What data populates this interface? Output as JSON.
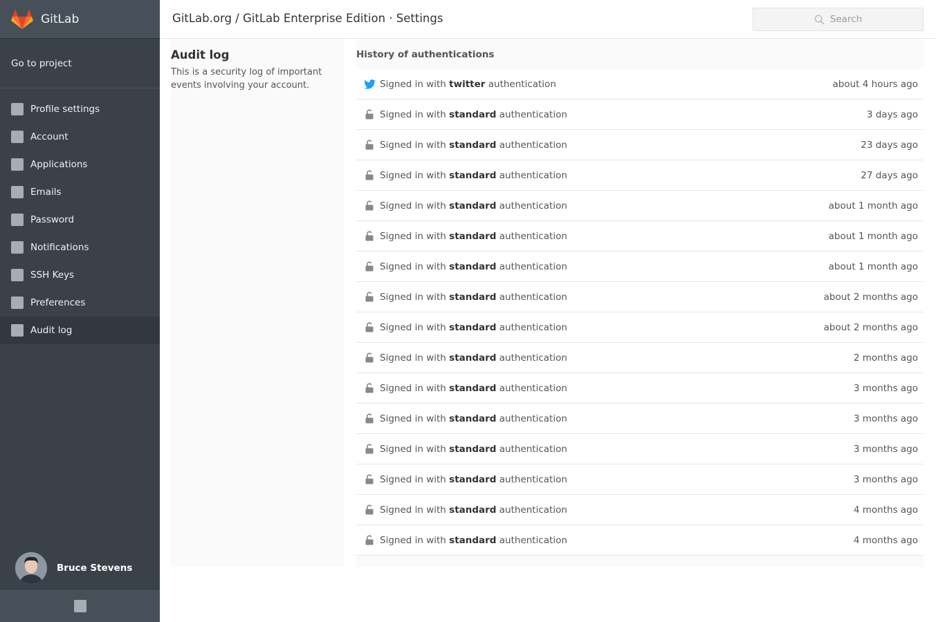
{
  "app": {
    "brand": "GitLab"
  },
  "header": {
    "breadcrumb": "GitLab.org / GitLab Enterprise Edition · Settings",
    "search_placeholder": "Search"
  },
  "sidebar": {
    "go_to_project": "Go to project",
    "items": [
      {
        "label": "Profile settings"
      },
      {
        "label": "Account"
      },
      {
        "label": "Applications"
      },
      {
        "label": "Emails"
      },
      {
        "label": "Password"
      },
      {
        "label": "Notifications"
      },
      {
        "label": "SSH Keys"
      },
      {
        "label": "Preferences"
      },
      {
        "label": "Audit log"
      }
    ],
    "user_name": "Bruce Stevens"
  },
  "page": {
    "title": "Audit log",
    "description": "This is a security log of important events involving your account."
  },
  "history": {
    "heading": "History of authentications",
    "prefix": "Signed in with",
    "suffix": "authentication",
    "rows": [
      {
        "icon": "twitter-icon",
        "method": "twitter",
        "time": "about 4 hours ago"
      },
      {
        "icon": "lock-icon",
        "method": "standard",
        "time": "3 days ago"
      },
      {
        "icon": "lock-icon",
        "method": "standard",
        "time": "23 days ago"
      },
      {
        "icon": "lock-icon",
        "method": "standard",
        "time": "27 days ago"
      },
      {
        "icon": "lock-icon",
        "method": "standard",
        "time": "about 1 month ago"
      },
      {
        "icon": "lock-icon",
        "method": "standard",
        "time": "about 1 month ago"
      },
      {
        "icon": "lock-icon",
        "method": "standard",
        "time": "about 1 month ago"
      },
      {
        "icon": "lock-icon",
        "method": "standard",
        "time": "about 2 months ago"
      },
      {
        "icon": "lock-icon",
        "method": "standard",
        "time": "about 2 months ago"
      },
      {
        "icon": "lock-icon",
        "method": "standard",
        "time": "2 months ago"
      },
      {
        "icon": "lock-icon",
        "method": "standard",
        "time": "3 months ago"
      },
      {
        "icon": "lock-icon",
        "method": "standard",
        "time": "3 months ago"
      },
      {
        "icon": "lock-icon",
        "method": "standard",
        "time": "3 months ago"
      },
      {
        "icon": "lock-icon",
        "method": "standard",
        "time": "3 months ago"
      },
      {
        "icon": "lock-icon",
        "method": "standard",
        "time": "4 months ago"
      },
      {
        "icon": "lock-icon",
        "method": "standard",
        "time": "4 months ago"
      }
    ]
  },
  "colors": {
    "sidebar_bg": "#3b4149",
    "sidebar_active": "#323840",
    "twitter": "#1da1f2",
    "gitlab_orange": "#fc6d26"
  }
}
